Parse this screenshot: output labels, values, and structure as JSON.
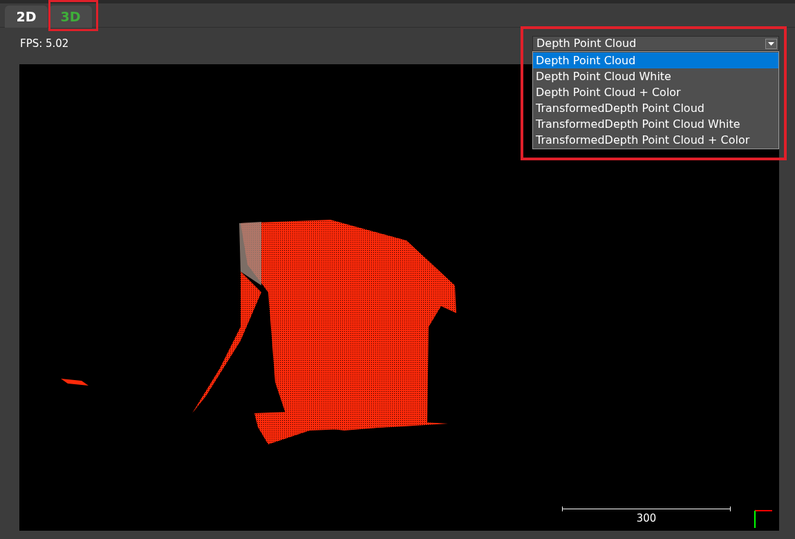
{
  "tabs": [
    {
      "label": "2D",
      "selected": false
    },
    {
      "label": "3D",
      "selected": true
    }
  ],
  "fps": "FPS: 5.02",
  "view_select": {
    "value": "Depth Point Cloud",
    "expanded": true,
    "options": [
      {
        "label": "Depth Point Cloud",
        "selected": true
      },
      {
        "label": "Depth Point Cloud White",
        "selected": false
      },
      {
        "label": "Depth Point Cloud + Color",
        "selected": false
      },
      {
        "label": "TransformedDepth Point Cloud",
        "selected": false
      },
      {
        "label": "TransformedDepth Point Cloud White",
        "selected": false
      },
      {
        "label": "TransformedDepth Point Cloud + Color",
        "selected": false
      }
    ]
  },
  "scale_bar": {
    "label": "300"
  }
}
